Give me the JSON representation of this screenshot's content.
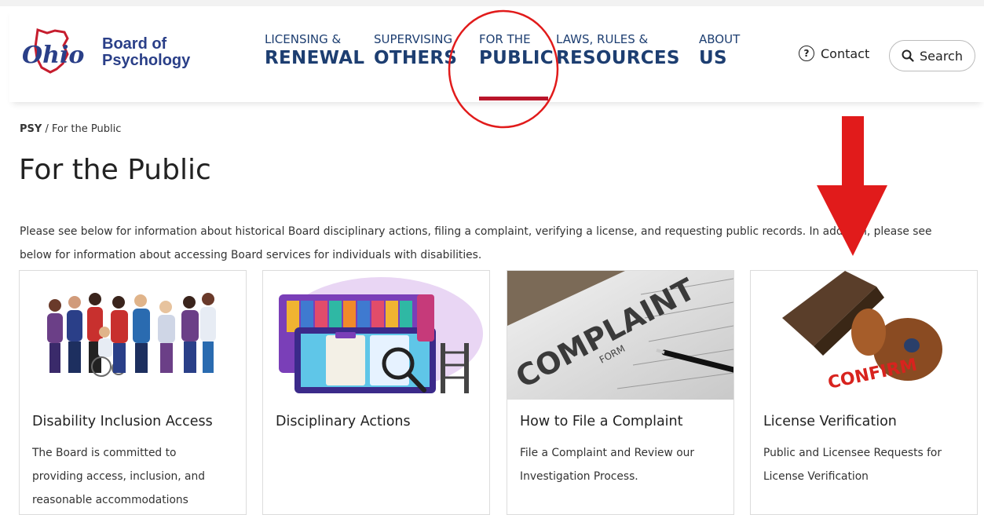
{
  "header": {
    "logo_script": "Ohio",
    "org_line1": "Board of",
    "org_line2": "Psychology",
    "nav": [
      {
        "small": "LICENSING &",
        "big": "RENEWAL"
      },
      {
        "small": "SUPERVISING",
        "big": "OTHERS"
      },
      {
        "small": "FOR THE",
        "big": "PUBLIC"
      },
      {
        "small": "LAWS, RULES &",
        "big": "RESOURCES"
      },
      {
        "small": "ABOUT",
        "big": "US"
      }
    ],
    "contact_icon": "?",
    "contact_label": "Contact",
    "search_label": "Search"
  },
  "breadcrumb": {
    "root": "PSY",
    "separator": "/",
    "current": "For the Public"
  },
  "page": {
    "title": "For the Public",
    "intro_line1": "Please see below for information about historical Board disciplinary actions, filing a complaint, verifying a license, and requesting public records. In addition, please see",
    "intro_line2": "below for information about accessing Board services for individuals with disabilities."
  },
  "cards": [
    {
      "title": "Disability Inclusion Access",
      "desc_lines": [
        "The Board is committed to",
        "providing access, inclusion, and",
        "reasonable accommodations"
      ],
      "icon": "diverse-people-illustration"
    },
    {
      "title": "Disciplinary Actions",
      "desc_lines": [],
      "icon": "records-folders-illustration"
    },
    {
      "title": "How to File a Complaint",
      "desc_lines": [
        "File a Complaint and Review our",
        "Investigation Process."
      ],
      "icon": "complaint-form-photo",
      "image_text": "COMPLAINT",
      "image_subtext": "FORM"
    },
    {
      "title": "License Verification",
      "desc_lines": [
        "Public and Licensee Requests for",
        "License Verification"
      ],
      "icon": "confirm-stamp-photo",
      "image_text": "CONFIRM"
    }
  ],
  "colors": {
    "navy": "#1d3e71",
    "brand_red": "#b9152a",
    "annotation_red": "#e11b1b"
  }
}
